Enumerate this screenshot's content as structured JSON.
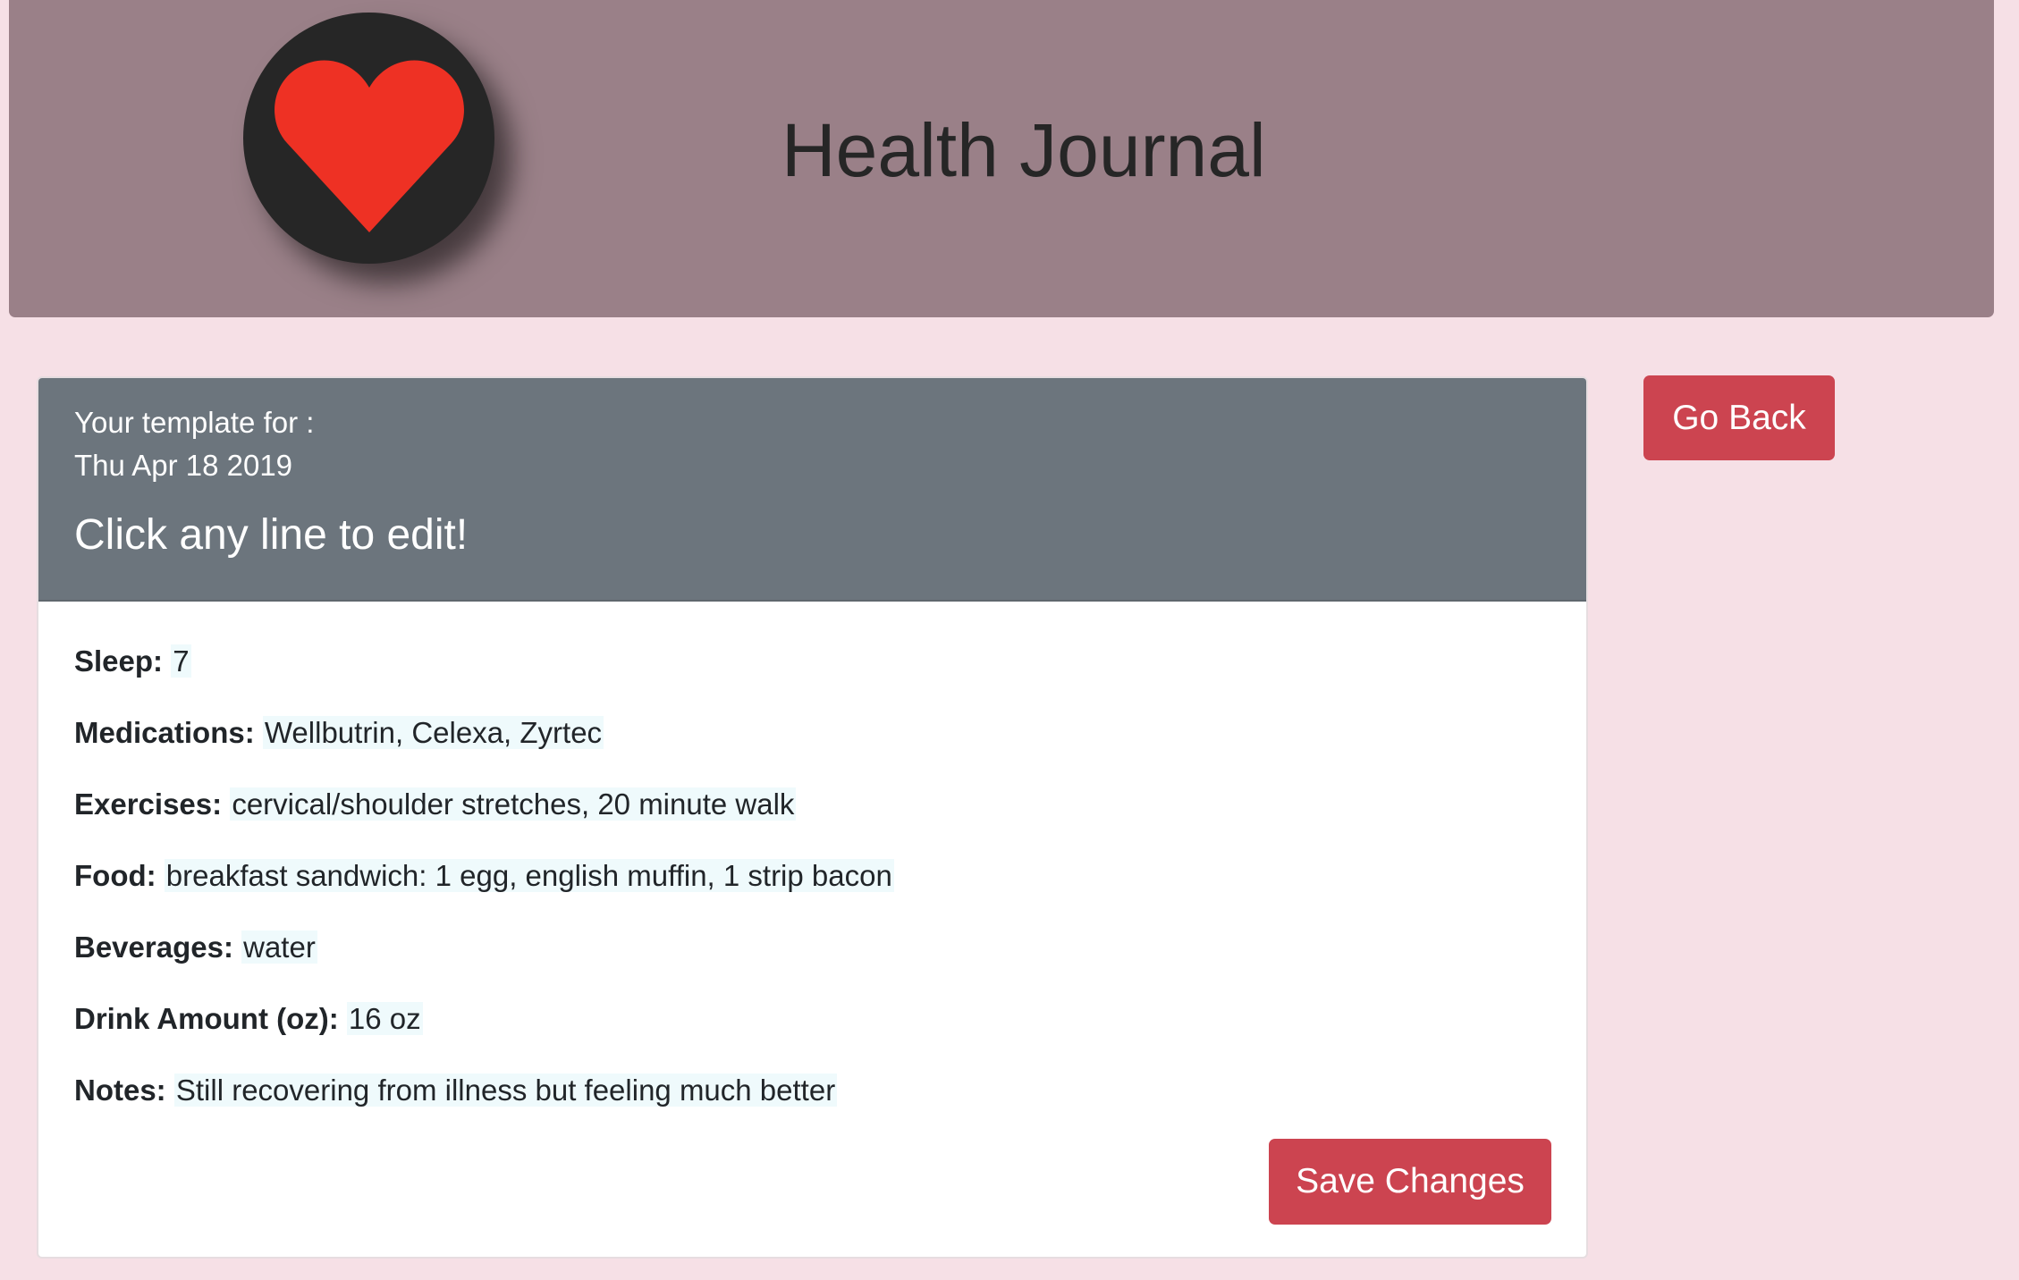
{
  "banner": {
    "title": "Health Journal",
    "logo_icon": "heart-icon",
    "heart_color": "#ee3124"
  },
  "template_card": {
    "intro_label": "Your template for :",
    "date": "Thu Apr 18 2019",
    "edit_hint": "Click any line to edit!",
    "fields": [
      {
        "label": "Sleep:",
        "value": "7"
      },
      {
        "label": "Medications:",
        "value": "Wellbutrin, Celexa, Zyrtec"
      },
      {
        "label": "Exercises:",
        "value": "cervical/shoulder stretches, 20 minute walk"
      },
      {
        "label": "Food:",
        "value": "breakfast sandwich: 1 egg, english muffin, 1 strip bacon"
      },
      {
        "label": "Beverages:",
        "value": "water"
      },
      {
        "label": "Drink Amount (oz):",
        "value": "16 oz"
      },
      {
        "label": "Notes:",
        "value": "Still recovering from illness but feeling much better"
      }
    ],
    "save_label": "Save Changes"
  },
  "go_back_label": "Go Back",
  "colors": {
    "page_bg": "#f6e0e6",
    "banner_bg": "#9a8088",
    "card_header_bg": "#6c757d",
    "button_red": "#cc4450"
  }
}
